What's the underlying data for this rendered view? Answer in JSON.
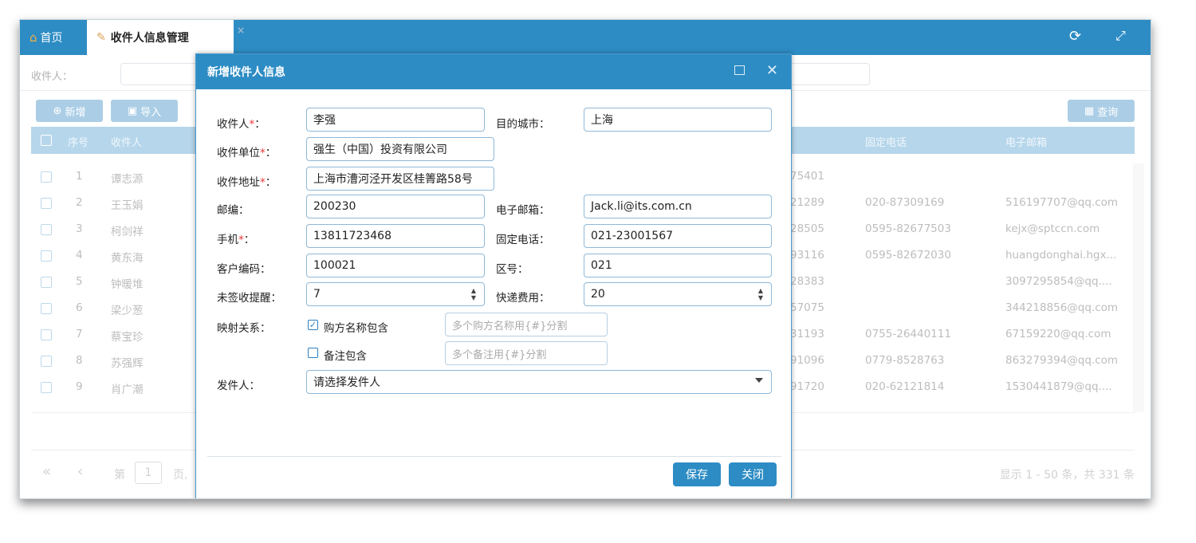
{
  "tabs": {
    "home_label": "首页",
    "active_label": "收件人信息管理",
    "close_glyph": "×"
  },
  "search": {
    "label": "收件人："
  },
  "toolbar": {
    "add_label": "新增",
    "import_label": "导入",
    "query_label": "查询"
  },
  "grid": {
    "columns": [
      "序号",
      "收件人",
      "固定电话",
      "电子邮箱"
    ],
    "rows": [
      {
        "no": "1",
        "name": "谭志源",
        "phone_tail": "75401",
        "tel": "",
        "email": ""
      },
      {
        "no": "2",
        "name": "王玉娟",
        "phone_tail": "21289",
        "tel": "020-87309169",
        "email": "516197707@qq.com"
      },
      {
        "no": "3",
        "name": "柯剑祥",
        "phone_tail": "28505",
        "tel": "0595-82677503",
        "email": "kejx@sptccn.com"
      },
      {
        "no": "4",
        "name": "黄东海",
        "phone_tail": "93116",
        "tel": "0595-82672030",
        "email": "huangdonghai.hgx..."
      },
      {
        "no": "5",
        "name": "钟暖堆",
        "phone_tail": "28383",
        "tel": "",
        "email": "3097295854@qq...."
      },
      {
        "no": "6",
        "name": "梁少葱",
        "phone_tail": "57075",
        "tel": "",
        "email": "344218856@qq.com"
      },
      {
        "no": "7",
        "name": "蔡宝珍",
        "phone_tail": "31193",
        "tel": "0755-26440111",
        "email": "67159220@qq.com"
      },
      {
        "no": "8",
        "name": "苏强辉",
        "phone_tail": "91096",
        "tel": "0779-8528763",
        "email": "863279394@qq.com"
      },
      {
        "no": "9",
        "name": "肖广潮",
        "phone_tail": "91720",
        "tel": "020-62121814",
        "email": "1530441879@qq...."
      }
    ]
  },
  "pager": {
    "page_prefix": "第",
    "page_value": "1",
    "page_suffix": "页,",
    "summary": "显示 1 - 50 条，共 331 条"
  },
  "dialog": {
    "title": "新增收件人信息",
    "fields": {
      "receiver_label": "收件人",
      "receiver_value": "李强",
      "city_label": "目的城市：",
      "city_value": "上海",
      "company_label": "收件单位",
      "company_value": "强生（中国）投资有限公司",
      "address_label": "收件地址",
      "address_value": "上海市漕河泾开发区桂箐路58号",
      "zip_label": "邮编：",
      "zip_value": "200230",
      "email_label": "电子邮箱：",
      "email_value": "Jack.li@its.com.cn",
      "mobile_label": "手机",
      "mobile_value": "13811723468",
      "tel_label": "固定电话：",
      "tel_value": "021-23001567",
      "code_label": "客户编码：",
      "code_value": "100021",
      "area_label": "区号：",
      "area_value": "021",
      "remind_label": "未签收提醒：",
      "remind_value": "7",
      "fee_label": "快递费用：",
      "fee_value": "20",
      "mapping_label": "映射关系：",
      "buyer_check_label": "购方名称包含",
      "buyer_placeholder": "多个购方名称用{#}分割",
      "note_check_label": "备注包含",
      "note_placeholder": "多个备注用{#}分割",
      "sender_label": "发件人：",
      "sender_value": "请选择发件人"
    },
    "required_mark": "*：",
    "save_label": "保存",
    "close_label": "关闭"
  }
}
